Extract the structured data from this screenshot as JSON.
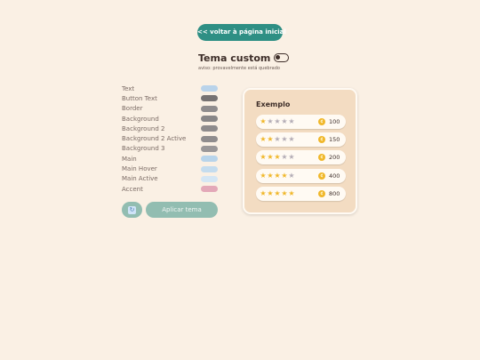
{
  "nav": {
    "back_label": "<< voltar à página inicial"
  },
  "header": {
    "title": "Tema custom",
    "warning": "aviso: provavelmente está quebrado"
  },
  "colors": [
    {
      "label": "Text",
      "color": "#b9d3ea"
    },
    {
      "label": "Button Text",
      "color": "#767272"
    },
    {
      "label": "Border",
      "color": "#8f8c8d"
    },
    {
      "label": "Background",
      "color": "#888687"
    },
    {
      "label": "Background 2",
      "color": "#8e8b8c"
    },
    {
      "label": "Background 2 Active",
      "color": "#8f8c8d"
    },
    {
      "label": "Background 3",
      "color": "#9a9798"
    },
    {
      "label": "Main",
      "color": "#b8d4ea"
    },
    {
      "label": "Main Hover",
      "color": "#c4dcee"
    },
    {
      "label": "Main Active",
      "color": "#d4e6f4"
    },
    {
      "label": "Accent",
      "color": "#e3a8b8"
    }
  ],
  "actions": {
    "reset_icon": "refresh-icon",
    "apply_label": "Aplicar tema"
  },
  "example": {
    "title": "Exemplo",
    "entries": [
      {
        "stars": 1,
        "points": "100"
      },
      {
        "stars": 2,
        "points": "150"
      },
      {
        "stars": 3,
        "points": "200"
      },
      {
        "stars": 4,
        "points": "400"
      },
      {
        "stars": 5,
        "points": "800"
      }
    ]
  }
}
